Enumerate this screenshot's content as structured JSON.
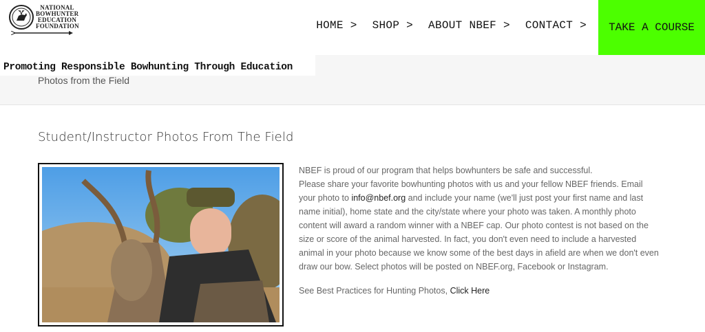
{
  "logo": {
    "lines": [
      "NATIONAL",
      "BOWHUNTER",
      "EDUCATION",
      "FOUNDATION"
    ]
  },
  "nav": [
    {
      "label": "HOME >"
    },
    {
      "label": "SHOP >"
    },
    {
      "label": "ABOUT NBEF >"
    },
    {
      "label": "CONTACT >"
    }
  ],
  "course_button": "TAKE A COURSE",
  "tagline": "Promoting Responsible Bowhunting Through Education",
  "breadcrumb": "Photos from the Field",
  "heading": "Student/Instructor Photos From The Field",
  "content": {
    "p1": "NBEF is proud of our program that helps bowhunters be safe and successful.",
    "p2_pre": "Please share your favorite bowhunting photos with us and your fellow NBEF friends. Email your photo to ",
    "email": "info@nbef.org",
    "p2_post": " and include your name (we'll just post your first name and last name initial), home state and the city/state where your photo was taken. A monthly photo content will award a random winner with a NBEF cap. Our photo contest is not based on the size or score of the animal harvested. In fact, you don't even need to include a harvested animal in your photo because we know some of the best days in afield are when we don't even draw our bow. Select photos will be posted on NBEF.org, Facebook or Instagram.",
    "p3_pre": "See Best Practices for Hunting Photos, ",
    "click_here": "Click Here"
  },
  "colors": {
    "accent": "#4cff00",
    "text": "#666666",
    "titlebar": "#f6f6f6"
  }
}
